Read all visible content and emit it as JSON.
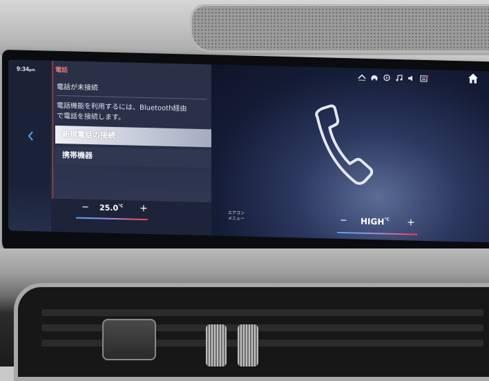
{
  "status": {
    "time": "9:34",
    "ampm": "pm"
  },
  "panel": {
    "title": "電話",
    "status_text": "電話が未接続",
    "info_line1": "電話機能を利用するには、Bluetooth経由",
    "info_line2": "で電話を接続します。",
    "items": [
      {
        "label": "新規電話の接続",
        "selected": true
      },
      {
        "label": "携帯機器",
        "selected": false
      }
    ]
  },
  "climate": {
    "left": {
      "minus": "−",
      "value": "25.0",
      "unit": "°C",
      "plus": "+"
    },
    "menu_label_line1": "エアコン",
    "menu_label_line2": "メニュー",
    "right": {
      "minus": "−",
      "value": "HIGH",
      "unit": "°C",
      "plus": "+"
    }
  },
  "icons": {
    "back": "chevron-left-icon",
    "home": "home-icon",
    "phone": "phone-handset-icon",
    "status": [
      "chevron-up-icon",
      "car-icon",
      "steering-assist-icon",
      "music-note-icon",
      "volume-icon",
      "notification-icon"
    ]
  },
  "colors": {
    "accent": "#4fa6ff",
    "title_red": "#d97a7a",
    "selected_bg": "#eef0f5"
  }
}
